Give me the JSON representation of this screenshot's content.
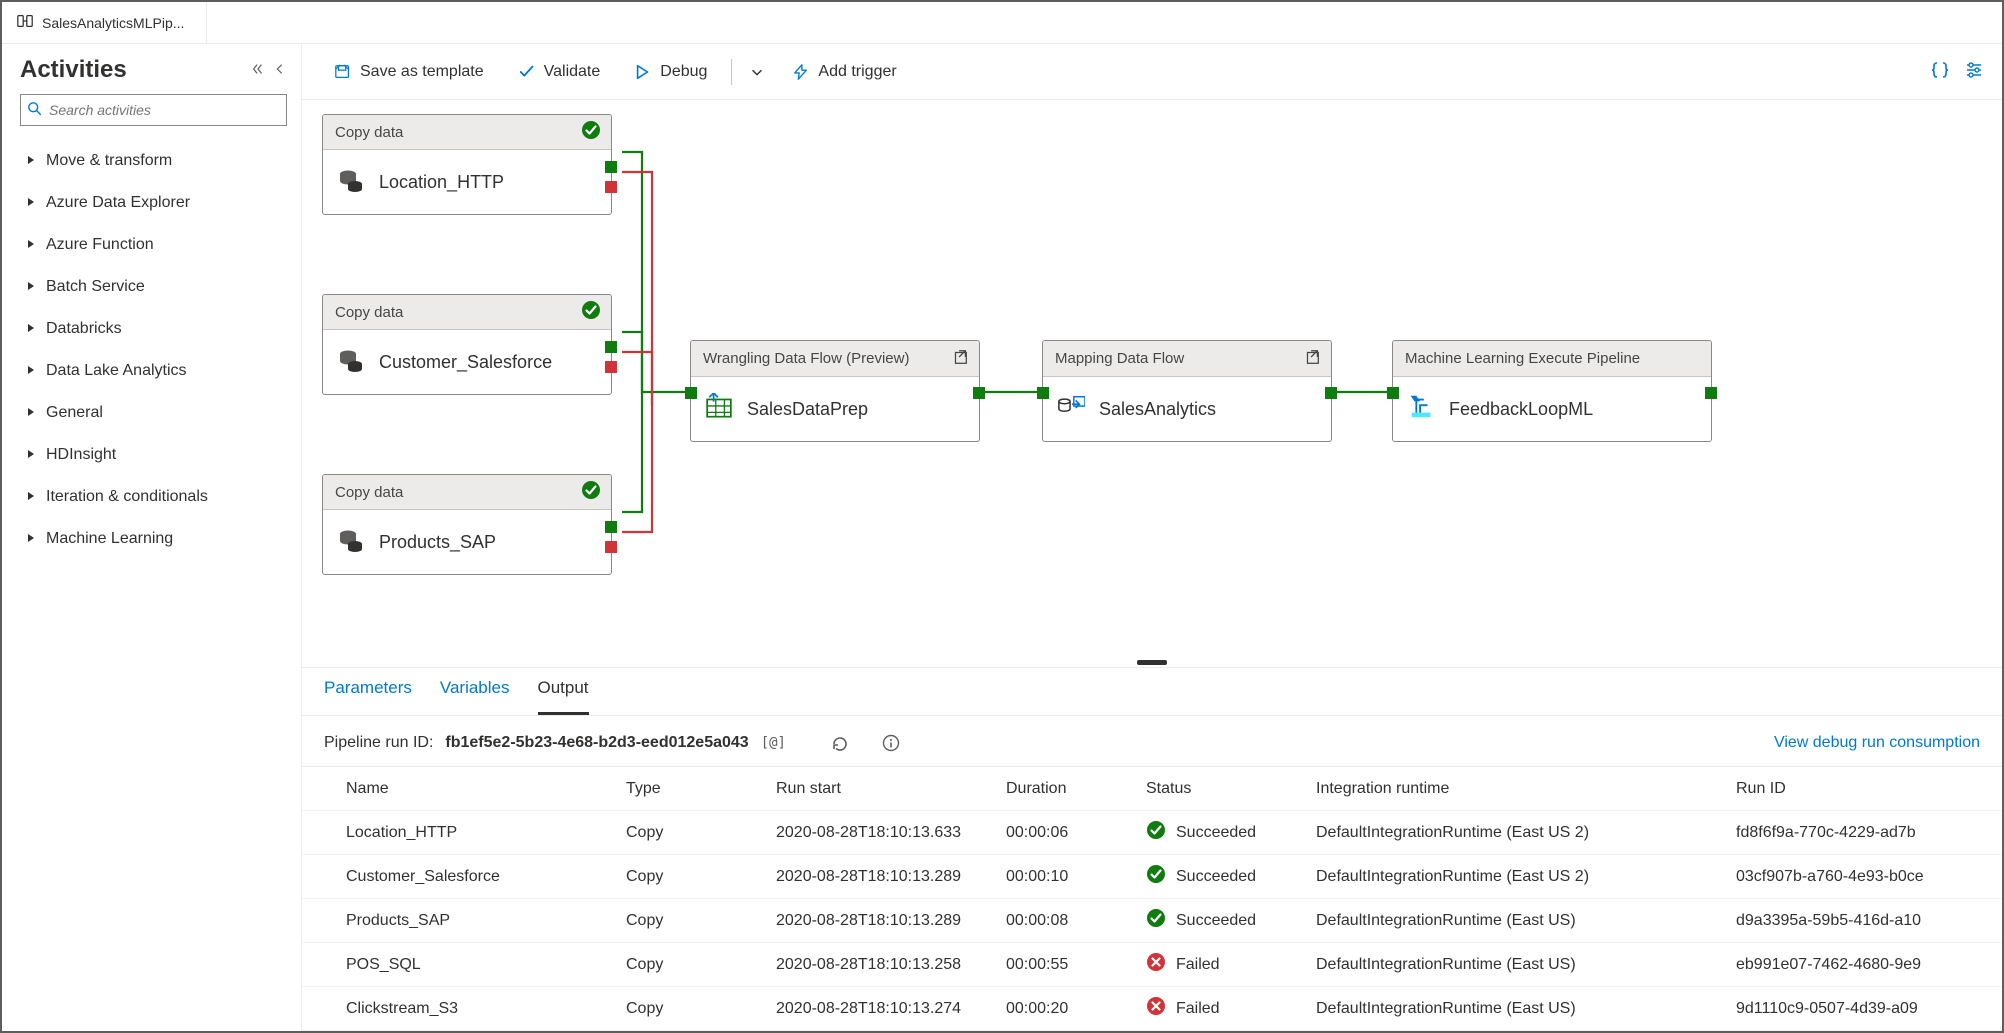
{
  "tab": {
    "title": "SalesAnalyticsMLPip..."
  },
  "sidebar": {
    "title": "Activities",
    "search_placeholder": "Search activities",
    "categories": [
      "Move & transform",
      "Azure Data Explorer",
      "Azure Function",
      "Batch Service",
      "Databricks",
      "Data Lake Analytics",
      "General",
      "HDInsight",
      "Iteration & conditionals",
      "Machine Learning"
    ]
  },
  "toolbar": {
    "save_template": "Save as template",
    "validate": "Validate",
    "debug": "Debug",
    "add_trigger": "Add trigger"
  },
  "canvas": {
    "n1": {
      "type": "Copy data",
      "name": "Location_HTTP"
    },
    "n2": {
      "type": "Copy data",
      "name": "Customer_Salesforce"
    },
    "n3": {
      "type": "Copy data",
      "name": "Products_SAP"
    },
    "n4": {
      "type": "Wrangling Data Flow (Preview)",
      "name": "SalesDataPrep"
    },
    "n5": {
      "type": "Mapping Data Flow",
      "name": "SalesAnalytics"
    },
    "n6": {
      "type": "Machine Learning Execute Pipeline",
      "name": "FeedbackLoopML"
    }
  },
  "bottom": {
    "tabs": {
      "parameters": "Parameters",
      "variables": "Variables",
      "output": "Output"
    },
    "run_label": "Pipeline run ID:",
    "run_id": "fb1ef5e2-5b23-4e68-b2d3-eed012e5a043",
    "view_link": "View debug run consumption",
    "columns": {
      "name": "Name",
      "type": "Type",
      "run_start": "Run start",
      "duration": "Duration",
      "status": "Status",
      "runtime": "Integration runtime",
      "runid": "Run ID"
    },
    "rows": [
      {
        "name": "Location_HTTP",
        "type": "Copy",
        "run_start": "2020-08-28T18:10:13.633",
        "duration": "00:00:06",
        "status": "Succeeded",
        "runtime": "DefaultIntegrationRuntime (East US 2)",
        "runid": "fd8f6f9a-770c-4229-ad7b"
      },
      {
        "name": "Customer_Salesforce",
        "type": "Copy",
        "run_start": "2020-08-28T18:10:13.289",
        "duration": "00:00:10",
        "status": "Succeeded",
        "runtime": "DefaultIntegrationRuntime (East US 2)",
        "runid": "03cf907b-a760-4e93-b0ce"
      },
      {
        "name": "Products_SAP",
        "type": "Copy",
        "run_start": "2020-08-28T18:10:13.289",
        "duration": "00:00:08",
        "status": "Succeeded",
        "runtime": "DefaultIntegrationRuntime (East US)",
        "runid": "d9a3395a-59b5-416d-a10"
      },
      {
        "name": "POS_SQL",
        "type": "Copy",
        "run_start": "2020-08-28T18:10:13.258",
        "duration": "00:00:55",
        "status": "Failed",
        "runtime": "DefaultIntegrationRuntime (East US)",
        "runid": "eb991e07-7462-4680-9e9"
      },
      {
        "name": "Clickstream_S3",
        "type": "Copy",
        "run_start": "2020-08-28T18:10:13.274",
        "duration": "00:00:20",
        "status": "Failed",
        "runtime": "DefaultIntegrationRuntime (East US)",
        "runid": "9d1110c9-0507-4d39-a09"
      }
    ]
  }
}
